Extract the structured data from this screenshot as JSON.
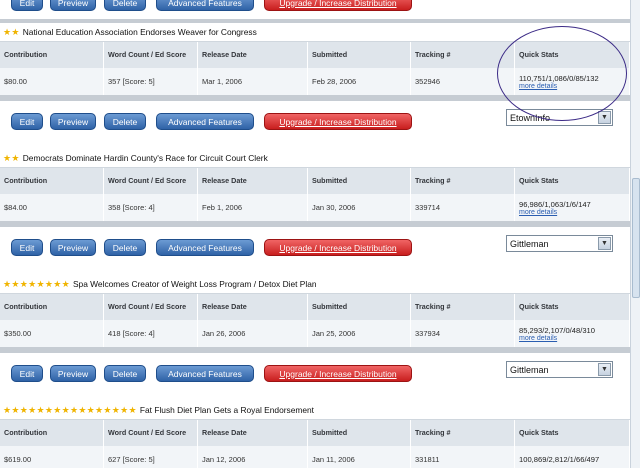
{
  "table_headers": {
    "contribution": "Contribution",
    "word_count": "Word Count / Ed Score",
    "release_date": "Release Date",
    "submitted": "Submitted",
    "tracking": "Tracking #",
    "quick_stats": "Quick Stats"
  },
  "buttons": {
    "edit": "Edit",
    "preview": "Preview",
    "delete": "Delete",
    "advanced": "Advanced Features",
    "upgrade": "Upgrade / Increase Distribution"
  },
  "top_partial_buttons": {
    "upgrade": "Upgrade / Increase Distribution"
  },
  "more_details_label": "more details",
  "articles": [
    {
      "stars": "★★",
      "star_count": 2,
      "title": "National Education Association Endorses Weaver for Congress",
      "contribution": "$80.00",
      "word_count": "357 [Score: 5]",
      "release_date": "Mar 1, 2006",
      "submitted": "Feb 28, 2006",
      "tracking": "352946",
      "quick_stats": "110,751/1,086/0/85/132",
      "select_value": "EtownInfo"
    },
    {
      "stars": "★★",
      "star_count": 2,
      "title": "Democrats Dominate Hardin County's Race for Circuit Court Clerk",
      "contribution": "$84.00",
      "word_count": "358 [Score: 4]",
      "release_date": "Feb 1, 2006",
      "submitted": "Jan 30, 2006",
      "tracking": "339714",
      "quick_stats": "96,986/1,063/1/6/147",
      "select_value": "Gittleman"
    },
    {
      "stars": "★★★★★★★★",
      "star_count": 8,
      "title": "Spa Welcomes Creator of Weight Loss Program / Detox Diet Plan",
      "contribution": "$350.00",
      "word_count": "418 [Score: 4]",
      "release_date": "Jan 26, 2006",
      "submitted": "Jan 25, 2006",
      "tracking": "337934",
      "quick_stats": "85,293/2,107/0/48/310",
      "select_value": "Gittleman"
    },
    {
      "stars": "★★★★★★★★★★★★★★★★",
      "star_count": 16,
      "title": "Fat Flush Diet Plan Gets a Royal Endorsement",
      "contribution": "$619.00",
      "word_count": "627 [Score: 5]",
      "release_date": "Jan 12, 2006",
      "submitted": "Jan 11, 2006",
      "tracking": "331811",
      "quick_stats": "100,869/2,812/1/66/497"
    }
  ],
  "colors": {
    "button_blue": "#2f62a6",
    "button_red": "#c81e1e",
    "header_bg": "#dfe5eb",
    "row_bg": "#f2f5f8",
    "star": "#f0b400",
    "annotation_circle": "#3b2a86"
  }
}
